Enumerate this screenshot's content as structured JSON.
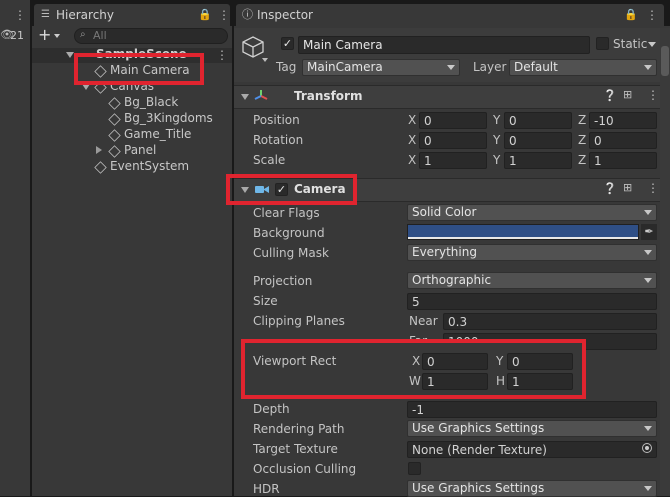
{
  "left_strip": {
    "badge": "21"
  },
  "hierarchy": {
    "tab_label": "Hierarchy",
    "search_placeholder": "All",
    "scene_name": "SampleScene",
    "items": [
      {
        "label": "Main Camera"
      },
      {
        "label": "Canvas"
      },
      {
        "label": "Bg_Black"
      },
      {
        "label": "Bg_3Kingdoms"
      },
      {
        "label": "Game_Title"
      },
      {
        "label": "Panel"
      },
      {
        "label": "EventSystem"
      }
    ]
  },
  "inspector": {
    "tab_label": "Inspector",
    "object_name": "Main Camera",
    "static_label": "Static",
    "tag_label": "Tag",
    "tag_value": "MainCamera",
    "layer_label": "Layer",
    "layer_value": "Default",
    "transform": {
      "title": "Transform",
      "position_label": "Position",
      "rotation_label": "Rotation",
      "scale_label": "Scale",
      "axis_x": "X",
      "axis_y": "Y",
      "axis_z": "Z",
      "position": {
        "x": "0",
        "y": "0",
        "z": "-10"
      },
      "rotation": {
        "x": "0",
        "y": "0",
        "z": "0"
      },
      "scale": {
        "x": "1",
        "y": "1",
        "z": "1"
      }
    },
    "camera": {
      "title": "Camera",
      "clear_flags_label": "Clear Flags",
      "clear_flags_value": "Solid Color",
      "background_label": "Background",
      "background_color": "#2f4f86",
      "culling_mask_label": "Culling Mask",
      "culling_mask_value": "Everything",
      "projection_label": "Projection",
      "projection_value": "Orthographic",
      "size_label": "Size",
      "size_value": "5",
      "clipping_label": "Clipping Planes",
      "near_label": "Near",
      "near_value": "0.3",
      "far_label": "Far",
      "far_value": "1000",
      "viewport_label": "Viewport Rect",
      "vp_x_label": "X",
      "vp_x": "0",
      "vp_y_label": "Y",
      "vp_y": "0",
      "vp_w_label": "W",
      "vp_w": "1",
      "vp_h_label": "H",
      "vp_h": "1",
      "depth_label": "Depth",
      "depth_value": "-1",
      "rendering_path_label": "Rendering Path",
      "rendering_path_value": "Use Graphics Settings",
      "target_texture_label": "Target Texture",
      "target_texture_value": "None (Render Texture)",
      "occlusion_label": "Occlusion Culling",
      "hdr_label": "HDR",
      "hdr_value": "Use Graphics Settings"
    }
  },
  "colors": {
    "highlight": "#e0242f",
    "accent_camera": "#6fb7e8"
  }
}
